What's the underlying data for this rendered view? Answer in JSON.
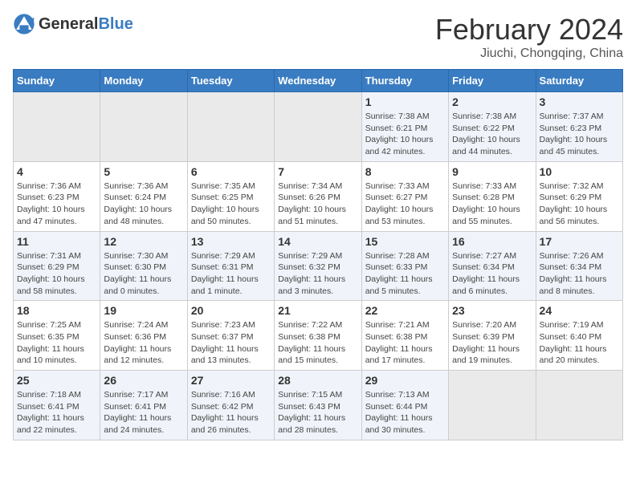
{
  "logo": {
    "text_general": "General",
    "text_blue": "Blue"
  },
  "header": {
    "month": "February 2024",
    "location": "Jiuchi, Chongqing, China"
  },
  "weekdays": [
    "Sunday",
    "Monday",
    "Tuesday",
    "Wednesday",
    "Thursday",
    "Friday",
    "Saturday"
  ],
  "weeks": [
    [
      {
        "day": "",
        "info": ""
      },
      {
        "day": "",
        "info": ""
      },
      {
        "day": "",
        "info": ""
      },
      {
        "day": "",
        "info": ""
      },
      {
        "day": "1",
        "info": "Sunrise: 7:38 AM\nSunset: 6:21 PM\nDaylight: 10 hours and 42 minutes."
      },
      {
        "day": "2",
        "info": "Sunrise: 7:38 AM\nSunset: 6:22 PM\nDaylight: 10 hours and 44 minutes."
      },
      {
        "day": "3",
        "info": "Sunrise: 7:37 AM\nSunset: 6:23 PM\nDaylight: 10 hours and 45 minutes."
      }
    ],
    [
      {
        "day": "4",
        "info": "Sunrise: 7:36 AM\nSunset: 6:23 PM\nDaylight: 10 hours and 47 minutes."
      },
      {
        "day": "5",
        "info": "Sunrise: 7:36 AM\nSunset: 6:24 PM\nDaylight: 10 hours and 48 minutes."
      },
      {
        "day": "6",
        "info": "Sunrise: 7:35 AM\nSunset: 6:25 PM\nDaylight: 10 hours and 50 minutes."
      },
      {
        "day": "7",
        "info": "Sunrise: 7:34 AM\nSunset: 6:26 PM\nDaylight: 10 hours and 51 minutes."
      },
      {
        "day": "8",
        "info": "Sunrise: 7:33 AM\nSunset: 6:27 PM\nDaylight: 10 hours and 53 minutes."
      },
      {
        "day": "9",
        "info": "Sunrise: 7:33 AM\nSunset: 6:28 PM\nDaylight: 10 hours and 55 minutes."
      },
      {
        "day": "10",
        "info": "Sunrise: 7:32 AM\nSunset: 6:29 PM\nDaylight: 10 hours and 56 minutes."
      }
    ],
    [
      {
        "day": "11",
        "info": "Sunrise: 7:31 AM\nSunset: 6:29 PM\nDaylight: 10 hours and 58 minutes."
      },
      {
        "day": "12",
        "info": "Sunrise: 7:30 AM\nSunset: 6:30 PM\nDaylight: 11 hours and 0 minutes."
      },
      {
        "day": "13",
        "info": "Sunrise: 7:29 AM\nSunset: 6:31 PM\nDaylight: 11 hours and 1 minute."
      },
      {
        "day": "14",
        "info": "Sunrise: 7:29 AM\nSunset: 6:32 PM\nDaylight: 11 hours and 3 minutes."
      },
      {
        "day": "15",
        "info": "Sunrise: 7:28 AM\nSunset: 6:33 PM\nDaylight: 11 hours and 5 minutes."
      },
      {
        "day": "16",
        "info": "Sunrise: 7:27 AM\nSunset: 6:34 PM\nDaylight: 11 hours and 6 minutes."
      },
      {
        "day": "17",
        "info": "Sunrise: 7:26 AM\nSunset: 6:34 PM\nDaylight: 11 hours and 8 minutes."
      }
    ],
    [
      {
        "day": "18",
        "info": "Sunrise: 7:25 AM\nSunset: 6:35 PM\nDaylight: 11 hours and 10 minutes."
      },
      {
        "day": "19",
        "info": "Sunrise: 7:24 AM\nSunset: 6:36 PM\nDaylight: 11 hours and 12 minutes."
      },
      {
        "day": "20",
        "info": "Sunrise: 7:23 AM\nSunset: 6:37 PM\nDaylight: 11 hours and 13 minutes."
      },
      {
        "day": "21",
        "info": "Sunrise: 7:22 AM\nSunset: 6:38 PM\nDaylight: 11 hours and 15 minutes."
      },
      {
        "day": "22",
        "info": "Sunrise: 7:21 AM\nSunset: 6:38 PM\nDaylight: 11 hours and 17 minutes."
      },
      {
        "day": "23",
        "info": "Sunrise: 7:20 AM\nSunset: 6:39 PM\nDaylight: 11 hours and 19 minutes."
      },
      {
        "day": "24",
        "info": "Sunrise: 7:19 AM\nSunset: 6:40 PM\nDaylight: 11 hours and 20 minutes."
      }
    ],
    [
      {
        "day": "25",
        "info": "Sunrise: 7:18 AM\nSunset: 6:41 PM\nDaylight: 11 hours and 22 minutes."
      },
      {
        "day": "26",
        "info": "Sunrise: 7:17 AM\nSunset: 6:41 PM\nDaylight: 11 hours and 24 minutes."
      },
      {
        "day": "27",
        "info": "Sunrise: 7:16 AM\nSunset: 6:42 PM\nDaylight: 11 hours and 26 minutes."
      },
      {
        "day": "28",
        "info": "Sunrise: 7:15 AM\nSunset: 6:43 PM\nDaylight: 11 hours and 28 minutes."
      },
      {
        "day": "29",
        "info": "Sunrise: 7:13 AM\nSunset: 6:44 PM\nDaylight: 11 hours and 30 minutes."
      },
      {
        "day": "",
        "info": ""
      },
      {
        "day": "",
        "info": ""
      }
    ]
  ]
}
